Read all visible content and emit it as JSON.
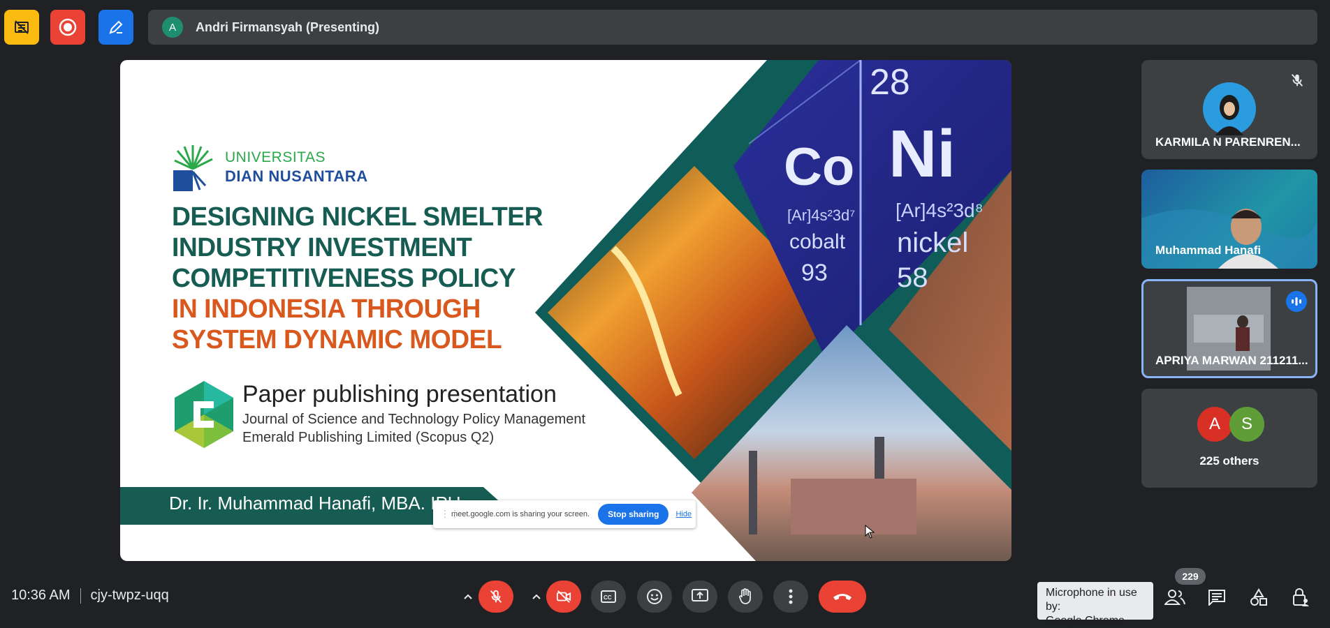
{
  "presenter": {
    "initial": "A",
    "name": "Andri Firmansyah (Presenting)"
  },
  "slide": {
    "university_line1": "UNIVERSITAS",
    "university_line2": "DIAN NUSANTARA",
    "title_lines": [
      "DESIGNING NICKEL SMELTER",
      "INDUSTRY INVESTMENT",
      "COMPETITIVENESS POLICY",
      "IN INDONESIA THROUGH",
      "SYSTEM DYNAMIC MODEL"
    ],
    "subtitle": "Paper publishing presentation",
    "journal": "Journal of Science and Technology Policy Management",
    "publisher": "Emerald Publishing Limited (Scopus Q2)",
    "author": "Dr. Ir. Muhammad Hanafi, MBA. IPU",
    "element_co": "Co",
    "element_co_config": "[Ar]4s²3d⁷",
    "element_co_name": "cobalt",
    "element_co_weight": "93",
    "element_ni_number": "28",
    "element_ni": "Ni",
    "element_ni_config": "[Ar]4s²3d⁸",
    "element_ni_name": "nickel",
    "element_ni_weight": "58"
  },
  "share_popup": {
    "text": "meet.google.com is sharing your screen.",
    "stop_label": "Stop sharing",
    "hide_label": "Hide"
  },
  "participants": [
    {
      "name": "KARMILA N PARENREN..."
    },
    {
      "name": "Muhammad Hanafi"
    },
    {
      "name": "APRIYA MARWAN 211211..."
    }
  ],
  "others": {
    "initial_a": "A",
    "initial_s": "S",
    "label": "225 others",
    "color_a": "#d93025",
    "color_s": "#5f9e36"
  },
  "meeting": {
    "time": "10:36 AM",
    "code": "cjy-twpz-uqq"
  },
  "tooltip": {
    "line1": "Microphone in use by:",
    "line2": "Google Chrome"
  },
  "people_count": "229",
  "colors": {
    "background": "#202124",
    "end_call": "#ea4335",
    "accent": "#1a73e8"
  }
}
